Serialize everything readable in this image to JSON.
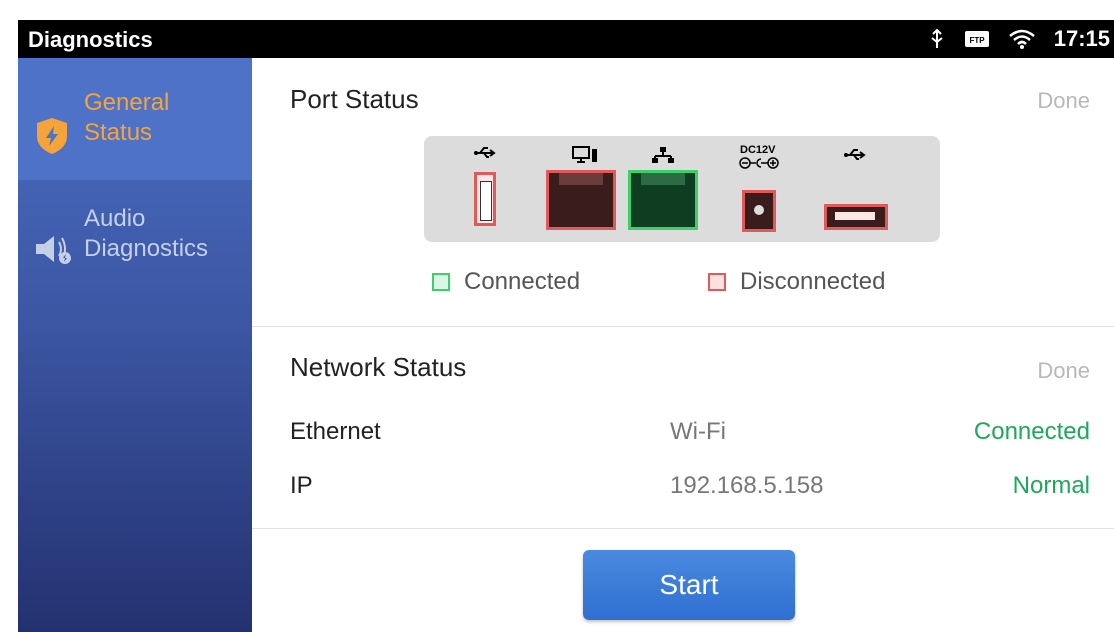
{
  "statusbar": {
    "title": "Diagnostics",
    "time": "17:15",
    "icons": [
      "usb-debug-icon",
      "ftp-icon",
      "wifi-icon"
    ],
    "ftp_label": "FTP"
  },
  "sidebar": {
    "items": [
      {
        "label_line1": "General",
        "label_line2": "Status",
        "icon": "shield-bolt-icon",
        "active": true
      },
      {
        "label_line1": "Audio",
        "label_line2": "Diagnostics",
        "icon": "speaker-icon",
        "active": false
      }
    ]
  },
  "port_status": {
    "title": "Port Status",
    "done": "Done",
    "dc_label": "DC12V",
    "ports": [
      {
        "name": "usb-port-1",
        "icon": "usb-icon",
        "state": "disconnected"
      },
      {
        "name": "pc-port",
        "icon": "computer-icon",
        "state": "disconnected"
      },
      {
        "name": "lan-port",
        "icon": "network-icon",
        "state": "connected"
      },
      {
        "name": "dc-power-port",
        "icon": "dc-polarity-icon",
        "state": "disconnected"
      },
      {
        "name": "usb-port-2",
        "icon": "usb-icon",
        "state": "disconnected"
      }
    ],
    "legend_connected": "Connected",
    "legend_disconnected": "Disconnected"
  },
  "network_status": {
    "title": "Network Status",
    "done": "Done",
    "rows": [
      {
        "key": "Ethernet",
        "value": "Wi-Fi",
        "status": "Connected"
      },
      {
        "key": "IP",
        "value": "192.168.5.158",
        "status": "Normal"
      }
    ]
  },
  "actions": {
    "start_label": "Start"
  },
  "colors": {
    "accent_orange": "#f5a43a",
    "connected_green": "#1ea85a",
    "disconnected_red": "#e05a5a",
    "button_blue": "#2f6fd0"
  }
}
